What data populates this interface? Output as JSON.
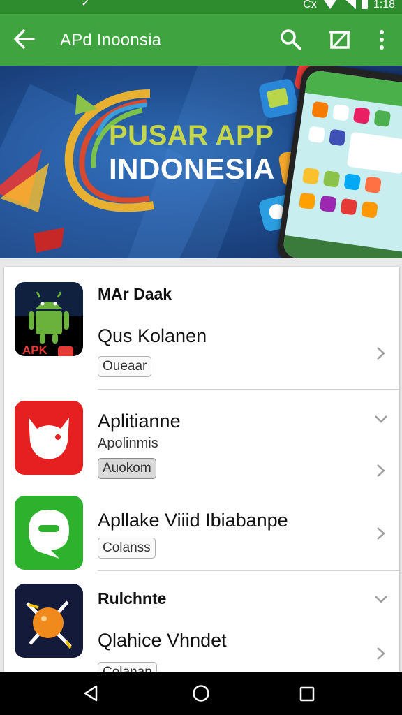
{
  "status_bar": {
    "time": "1:18",
    "carrier_glyph": "Cx"
  },
  "app_bar": {
    "title": "APd Inoonsia"
  },
  "banner": {
    "line1": "PUSAR APP",
    "line2": "INDONESIA"
  },
  "apps": [
    {
      "category": "MAr Daak",
      "name": "Qus Kolanen",
      "tag": "Oueaar",
      "icon": "android-apk-icon",
      "icon_label": "APK"
    },
    {
      "category": "",
      "name": "Aplitianne",
      "subtitle": "Apolinmis",
      "tag": "Auokom",
      "icon": "red-devil-icon"
    },
    {
      "category": "",
      "name": "Apllake Viiid Ibiabanpe",
      "tag": "Colanss",
      "icon": "green-chat-icon"
    },
    {
      "category": "Rulchnte",
      "name": "Qlahice Vhndet",
      "tag": "Colanan",
      "icon": "orange-ball-icon"
    }
  ],
  "colors": {
    "status_green": "#2e8b2e",
    "appbar_green": "#3fa33f",
    "banner_blue": "#1f4d8e"
  }
}
